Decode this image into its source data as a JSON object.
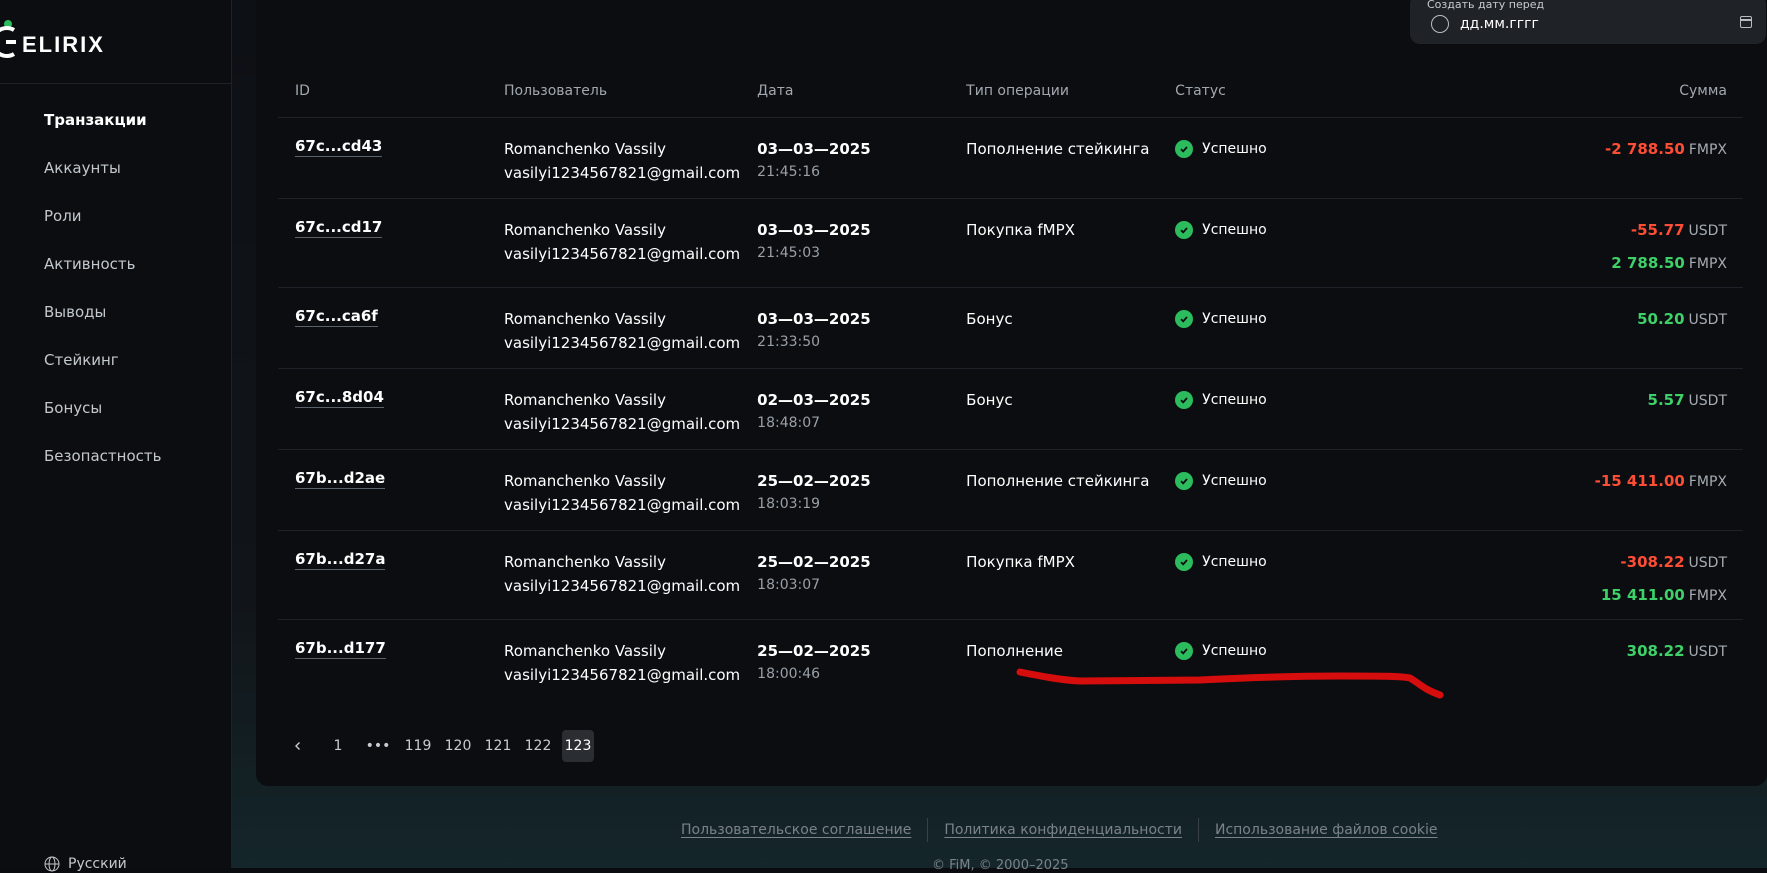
{
  "brand": {
    "logo_text": "ELIRIX",
    "accent": "#2cbb5d"
  },
  "sidebar": {
    "items": [
      {
        "label": "Транзакции",
        "active": true
      },
      {
        "label": "Аккаунты"
      },
      {
        "label": "Роли"
      },
      {
        "label": "Активность"
      },
      {
        "label": "Выводы"
      },
      {
        "label": "Стейкинг"
      },
      {
        "label": "Бонусы"
      },
      {
        "label": "Безопастность"
      }
    ],
    "language": "Русский"
  },
  "filter": {
    "label": "Создать дату перед",
    "placeholder": "дд.мм.гггг"
  },
  "table": {
    "headers": {
      "id": "ID",
      "user": "Пользователь",
      "date": "Дата",
      "type": "Тип операции",
      "status": "Статус",
      "sum": "Сумма"
    },
    "rows": [
      {
        "id": "67c...cd43",
        "name": "Romanchenko Vassily",
        "email": "vasilyi1234567821@gmail.com",
        "date": "03—03—2025",
        "time": "21:45:16",
        "type": "Пополнение стейкинга",
        "status": "Успешно",
        "amounts": [
          {
            "value": "-2 788.50",
            "currency": "FMPX",
            "sign": "neg"
          }
        ]
      },
      {
        "id": "67c...cd17",
        "name": "Romanchenko Vassily",
        "email": "vasilyi1234567821@gmail.com",
        "date": "03—03—2025",
        "time": "21:45:03",
        "type": "Покупка fMPX",
        "status": "Успешно",
        "amounts": [
          {
            "value": "-55.77",
            "currency": "USDT",
            "sign": "neg"
          },
          {
            "value": "2 788.50",
            "currency": "FMPX",
            "sign": "pos"
          }
        ]
      },
      {
        "id": "67c...ca6f",
        "name": "Romanchenko Vassily",
        "email": "vasilyi1234567821@gmail.com",
        "date": "03—03—2025",
        "time": "21:33:50",
        "type": "Бонус",
        "status": "Успешно",
        "amounts": [
          {
            "value": "50.20",
            "currency": "USDT",
            "sign": "pos"
          }
        ]
      },
      {
        "id": "67c...8d04",
        "name": "Romanchenko Vassily",
        "email": "vasilyi1234567821@gmail.com",
        "date": "02—03—2025",
        "time": "18:48:07",
        "type": "Бонус",
        "status": "Успешно",
        "amounts": [
          {
            "value": "5.57",
            "currency": "USDT",
            "sign": "pos"
          }
        ]
      },
      {
        "id": "67b...d2ae",
        "name": "Romanchenko Vassily",
        "email": "vasilyi1234567821@gmail.com",
        "date": "25—02—2025",
        "time": "18:03:19",
        "type": "Пополнение стейкинга",
        "status": "Успешно",
        "amounts": [
          {
            "value": "-15 411.00",
            "currency": "FMPX",
            "sign": "neg"
          }
        ]
      },
      {
        "id": "67b...d27a",
        "name": "Romanchenko Vassily",
        "email": "vasilyi1234567821@gmail.com",
        "date": "25—02—2025",
        "time": "18:03:07",
        "type": "Покупка fMPX",
        "status": "Успешно",
        "amounts": [
          {
            "value": "-308.22",
            "currency": "USDT",
            "sign": "neg"
          },
          {
            "value": "15 411.00",
            "currency": "FMPX",
            "sign": "pos"
          }
        ]
      },
      {
        "id": "67b...d177",
        "name": "Romanchenko Vassily",
        "email": "vasilyi1234567821@gmail.com",
        "date": "25—02—2025",
        "time": "18:00:46",
        "type": "Пополнение",
        "status": "Успешно",
        "amounts": [
          {
            "value": "308.22",
            "currency": "USDT",
            "sign": "pos"
          }
        ]
      }
    ]
  },
  "pagination": {
    "prev_icon": "chevron-left-icon",
    "pages": [
      "1",
      "•••",
      "119",
      "120",
      "121",
      "122",
      "123"
    ],
    "current": "123"
  },
  "footer": {
    "links": [
      "Пользовательское соглашение",
      "Политика конфиденциальности",
      "Использование файлов cookie"
    ],
    "copyright": "© FiM, © 2000–2025"
  },
  "colors": {
    "negative": "#ff4d36",
    "positive": "#3ed16a",
    "success": "#2cbb5d",
    "annotation": "#d60d0d"
  }
}
